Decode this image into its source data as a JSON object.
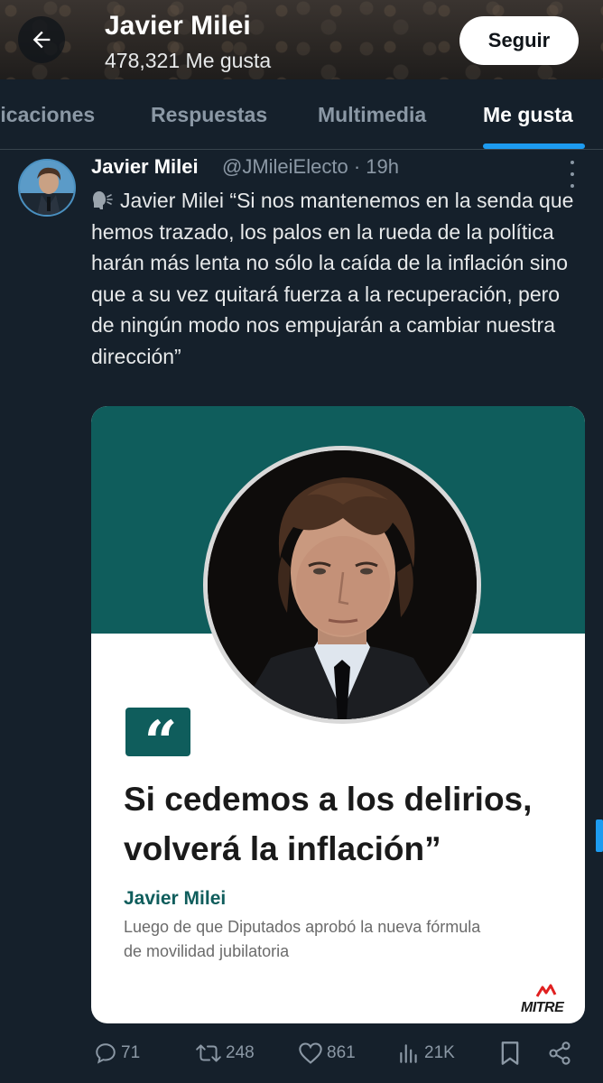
{
  "header": {
    "title": "Javier Milei",
    "subtitle": "478,321 Me gusta",
    "follow_label": "Seguir"
  },
  "tabs": [
    {
      "label": "Publicaciones",
      "visible_label": "licaciones",
      "active": false
    },
    {
      "label": "Respuestas",
      "active": false
    },
    {
      "label": "Multimedia",
      "active": false
    },
    {
      "label": "Me gusta",
      "active": true
    }
  ],
  "tweet": {
    "author_name": "Javier Milei",
    "handle_time": "@JMileiElecto · 19h",
    "text": "Javier Milei  “Si nos mantenemos en la senda que hemos trazado, los palos en la rueda de la política harán más lenta no sólo la caída de la inflación sino que a su vez quitará fuerza a la recuperación, pero de ningún modo nos empujarán a cambiar nuestra dirección”",
    "card": {
      "quote_glyph": "“",
      "headline": "Si cedemos a los delirios, volverá la inflación”",
      "author": "Javier Milei",
      "subtitle": "Luego de que Diputados aprobó la nueva fórmula de movilidad jubilatoria",
      "logo_text": "MITRE",
      "brand_color": "#0f5d5c"
    },
    "actions": {
      "replies": "71",
      "retweets": "248",
      "likes": "861",
      "views": "21K"
    }
  },
  "colors": {
    "background": "#15202b",
    "accent": "#1d9bf0",
    "muted": "#8b98a5"
  }
}
